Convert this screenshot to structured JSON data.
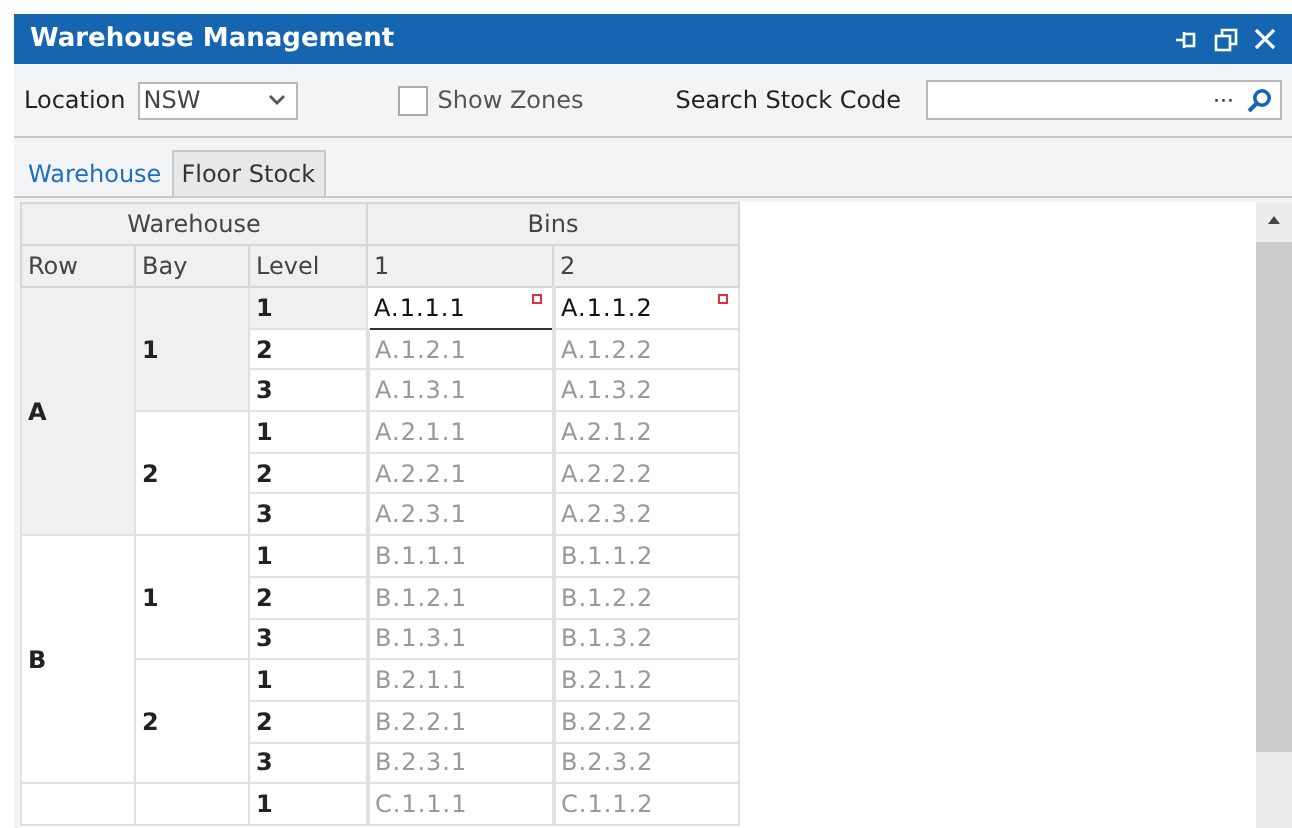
{
  "window": {
    "title": "Warehouse Management"
  },
  "toolbar": {
    "location_label": "Location",
    "location_value": "NSW",
    "show_zones": {
      "label": "Show Zones",
      "checked": false
    },
    "search_label": "Search Stock Code",
    "search_more": "···"
  },
  "tabs": [
    {
      "label": "Warehouse",
      "selected": true
    },
    {
      "label": "Floor Stock",
      "selected": false
    }
  ],
  "grid": {
    "group_headers": [
      "Warehouse",
      "Bins"
    ],
    "columns": [
      "Row",
      "Bay",
      "Level",
      "1",
      "2"
    ],
    "rows": [
      {
        "label": "A",
        "selected": true,
        "bays": [
          {
            "label": "1",
            "selected": true,
            "levels": [
              {
                "label": "1",
                "selected": true,
                "bins": [
                  {
                    "code": "A.1.1.1",
                    "active": true,
                    "flagged": true,
                    "focused": true
                  },
                  {
                    "code": "A.1.1.2",
                    "active": true,
                    "flagged": true,
                    "focused": false
                  }
                ]
              },
              {
                "label": "2",
                "selected": false,
                "bins": [
                  {
                    "code": "A.1.2.1",
                    "active": false,
                    "flagged": false,
                    "focused": false
                  },
                  {
                    "code": "A.1.2.2",
                    "active": false,
                    "flagged": false,
                    "focused": false
                  }
                ]
              },
              {
                "label": "3",
                "selected": false,
                "bins": [
                  {
                    "code": "A.1.3.1",
                    "active": false,
                    "flagged": false,
                    "focused": false
                  },
                  {
                    "code": "A.1.3.2",
                    "active": false,
                    "flagged": false,
                    "focused": false
                  }
                ]
              }
            ]
          },
          {
            "label": "2",
            "selected": false,
            "levels": [
              {
                "label": "1",
                "selected": false,
                "bins": [
                  {
                    "code": "A.2.1.1",
                    "active": false,
                    "flagged": false,
                    "focused": false
                  },
                  {
                    "code": "A.2.1.2",
                    "active": false,
                    "flagged": false,
                    "focused": false
                  }
                ]
              },
              {
                "label": "2",
                "selected": false,
                "bins": [
                  {
                    "code": "A.2.2.1",
                    "active": false,
                    "flagged": false,
                    "focused": false
                  },
                  {
                    "code": "A.2.2.2",
                    "active": false,
                    "flagged": false,
                    "focused": false
                  }
                ]
              },
              {
                "label": "3",
                "selected": false,
                "bins": [
                  {
                    "code": "A.2.3.1",
                    "active": false,
                    "flagged": false,
                    "focused": false
                  },
                  {
                    "code": "A.2.3.2",
                    "active": false,
                    "flagged": false,
                    "focused": false
                  }
                ]
              }
            ]
          }
        ]
      },
      {
        "label": "B",
        "selected": false,
        "bays": [
          {
            "label": "1",
            "selected": false,
            "levels": [
              {
                "label": "1",
                "selected": false,
                "bins": [
                  {
                    "code": "B.1.1.1",
                    "active": false,
                    "flagged": false,
                    "focused": false
                  },
                  {
                    "code": "B.1.1.2",
                    "active": false,
                    "flagged": false,
                    "focused": false
                  }
                ]
              },
              {
                "label": "2",
                "selected": false,
                "bins": [
                  {
                    "code": "B.1.2.1",
                    "active": false,
                    "flagged": false,
                    "focused": false
                  },
                  {
                    "code": "B.1.2.2",
                    "active": false,
                    "flagged": false,
                    "focused": false
                  }
                ]
              },
              {
                "label": "3",
                "selected": false,
                "bins": [
                  {
                    "code": "B.1.3.1",
                    "active": false,
                    "flagged": false,
                    "focused": false
                  },
                  {
                    "code": "B.1.3.2",
                    "active": false,
                    "flagged": false,
                    "focused": false
                  }
                ]
              }
            ]
          },
          {
            "label": "2",
            "selected": false,
            "levels": [
              {
                "label": "1",
                "selected": false,
                "bins": [
                  {
                    "code": "B.2.1.1",
                    "active": false,
                    "flagged": false,
                    "focused": false
                  },
                  {
                    "code": "B.2.1.2",
                    "active": false,
                    "flagged": false,
                    "focused": false
                  }
                ]
              },
              {
                "label": "2",
                "selected": false,
                "bins": [
                  {
                    "code": "B.2.2.1",
                    "active": false,
                    "flagged": false,
                    "focused": false
                  },
                  {
                    "code": "B.2.2.2",
                    "active": false,
                    "flagged": false,
                    "focused": false
                  }
                ]
              },
              {
                "label": "3",
                "selected": false,
                "bins": [
                  {
                    "code": "B.2.3.1",
                    "active": false,
                    "flagged": false,
                    "focused": false
                  },
                  {
                    "code": "B.2.3.2",
                    "active": false,
                    "flagged": false,
                    "focused": false
                  }
                ]
              }
            ]
          }
        ]
      },
      {
        "selected": false,
        "bays": [
          {
            "selected": false,
            "levels": [
              {
                "label": "1",
                "selected": false,
                "bins": [
                  {
                    "code": "C.1.1.1",
                    "active": false,
                    "flagged": false,
                    "focused": false
                  },
                  {
                    "code": "C.1.1.2",
                    "active": false,
                    "flagged": false,
                    "focused": false
                  }
                ]
              }
            ]
          }
        ]
      }
    ]
  }
}
